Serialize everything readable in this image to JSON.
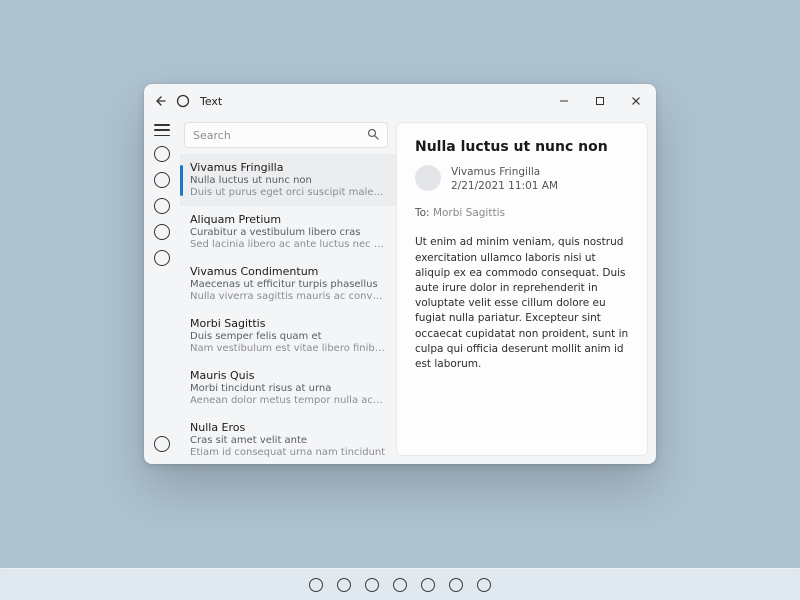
{
  "window": {
    "title": "Text"
  },
  "search": {
    "placeholder": "Search"
  },
  "messages": [
    {
      "from": "Vivamus Fringilla",
      "subject": "Nulla luctus ut nunc non",
      "preview": "Duis ut purus eget orci suscipit malesuada",
      "selected": true
    },
    {
      "from": "Aliquam Pretium",
      "subject": "Curabitur a vestibulum libero cras",
      "preview": "Sed lacinia libero ac ante luctus nec interdum"
    },
    {
      "from": "Vivamus Condimentum",
      "subject": "Maecenas ut efficitur turpis phasellus",
      "preview": "Nulla viverra sagittis mauris ac convallis"
    },
    {
      "from": "Morbi Sagittis",
      "subject": "Duis semper felis quam et",
      "preview": "Nam vestibulum est vitae libero finibus et"
    },
    {
      "from": "Mauris Quis",
      "subject": "Morbi tincidunt risus at urna",
      "preview": "Aenean dolor metus tempor nulla ac dapibus"
    },
    {
      "from": "Nulla Eros",
      "subject": "Cras sit amet velit ante",
      "preview": "Etiam id consequat urna nam tincidunt"
    }
  ],
  "reading": {
    "subject": "Nulla luctus ut nunc non",
    "from": "Vivamus Fringilla",
    "datetime": "2/21/2021 11:01 AM",
    "to_label": "To:",
    "to_value": "Morbi Sagittis",
    "body": "Ut enim ad minim veniam, quis nostrud exercitation ullamco laboris nisi ut aliquip ex ea commodo consequat. Duis aute irure dolor in reprehenderit in voluptate velit esse cillum dolore eu fugiat nulla pariatur. Excepteur sint occaecat cupidatat non proident, sunt in culpa qui officia deserunt mollit anim id est laborum."
  },
  "taskbar_items": 7
}
